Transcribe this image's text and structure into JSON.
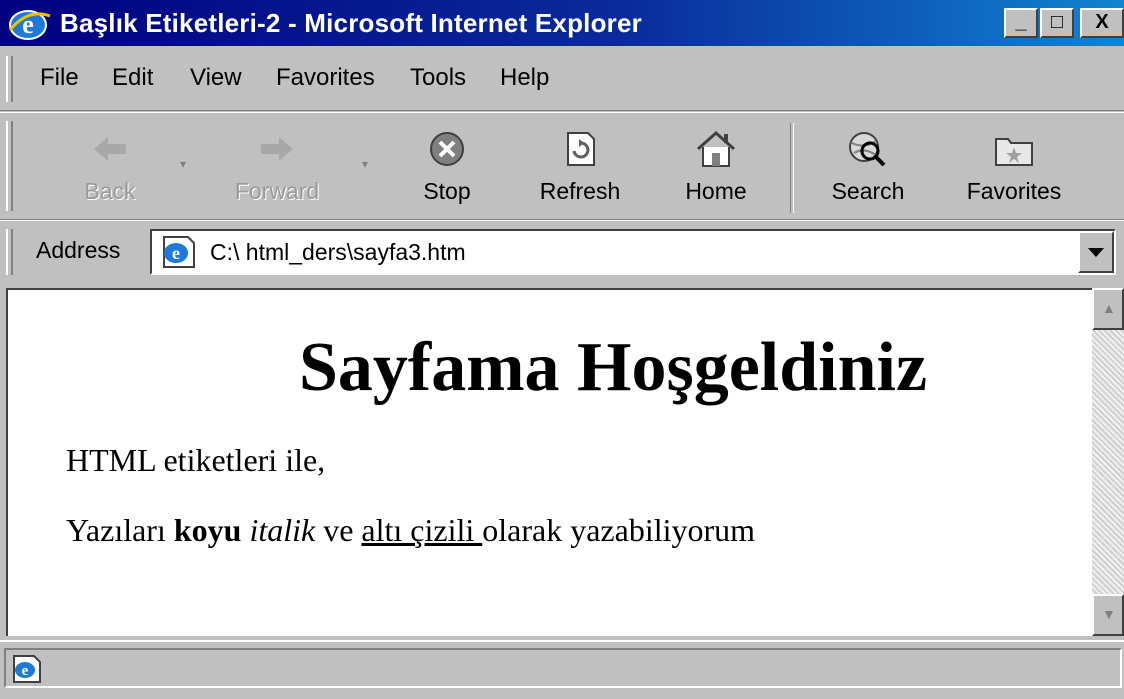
{
  "window": {
    "title": "Başlık Etiketleri-2 - Microsoft Internet Explorer",
    "controls": {
      "minimize": "_",
      "maximize": "□",
      "close": "X"
    }
  },
  "menu": {
    "items": [
      {
        "label": "File"
      },
      {
        "label": "Edit"
      },
      {
        "label": "View"
      },
      {
        "label": "Favorites"
      },
      {
        "label": "Tools"
      },
      {
        "label": "Help"
      }
    ]
  },
  "toolbar": {
    "back": {
      "label": "Back",
      "icon": "back-arrow-icon",
      "enabled": false
    },
    "forward": {
      "label": "Forward",
      "icon": "forward-arrow-icon",
      "enabled": false
    },
    "stop": {
      "label": "Stop",
      "icon": "stop-icon"
    },
    "refresh": {
      "label": "Refresh",
      "icon": "refresh-icon"
    },
    "home": {
      "label": "Home",
      "icon": "home-icon"
    },
    "search": {
      "label": "Search",
      "icon": "search-globe-icon"
    },
    "favorites": {
      "label": "Favorites",
      "icon": "favorites-folder-icon"
    }
  },
  "address": {
    "label": "Address",
    "url": "C:\\ html_ders\\sayfa3.htm"
  },
  "page": {
    "heading": "Sayfama Hoşgeldiniz",
    "para1": "HTML etiketleri ile,",
    "para2": {
      "prefix": "Yazıları ",
      "bold": "koyu",
      "space1": " ",
      "italic": "italik",
      "middle": " ve ",
      "underline": "altı çizili ",
      "suffix": "olarak yazabiliyorum"
    }
  },
  "colors": {
    "titlebar_start": "#000080",
    "titlebar_end": "#1084d0",
    "chrome": "#c0c0c0",
    "content_bg": "#ffffff"
  }
}
